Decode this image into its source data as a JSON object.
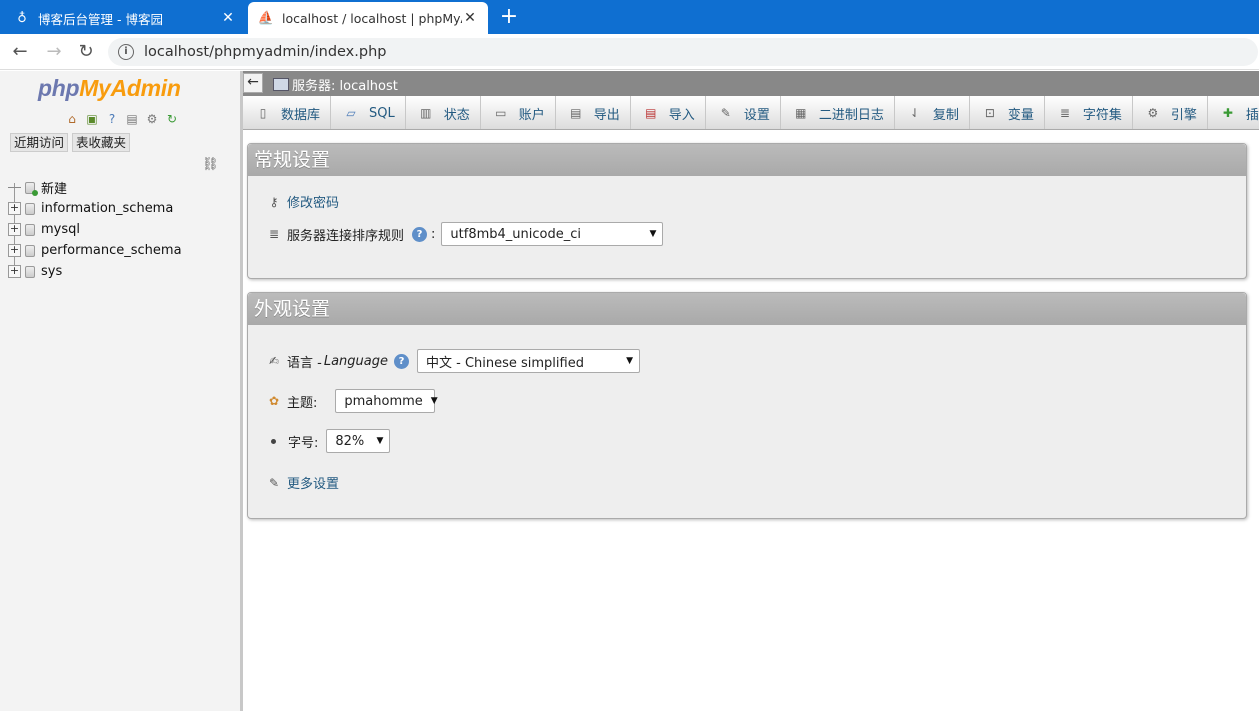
{
  "browser": {
    "tabs": [
      {
        "title": "博客后台管理 - 博客园",
        "active": false
      },
      {
        "title": "localhost / localhost | phpMyA",
        "active": true
      }
    ],
    "new_tab": "+",
    "url": "localhost/phpmyadmin/index.php"
  },
  "sidebar": {
    "logo_part1": "php",
    "logo_part2": "MyAdmin",
    "icons": [
      "home-icon",
      "exit-icon",
      "help-icon",
      "docs-icon",
      "settings-icon",
      "reload-icon"
    ],
    "quick_links": [
      "近期访问",
      "表收藏夹"
    ],
    "tree": [
      {
        "label": "新建",
        "type": "new"
      },
      {
        "label": "information_schema",
        "type": "db"
      },
      {
        "label": "mysql",
        "type": "db"
      },
      {
        "label": "performance_schema",
        "type": "db"
      },
      {
        "label": "sys",
        "type": "db"
      }
    ]
  },
  "serverbar": {
    "collapse": "←",
    "label": "服务器: localhost"
  },
  "menu": [
    {
      "label": "数据库",
      "icon": "database-icon"
    },
    {
      "label": "SQL",
      "icon": "sql-icon"
    },
    {
      "label": "状态",
      "icon": "status-icon"
    },
    {
      "label": "账户",
      "icon": "accounts-icon"
    },
    {
      "label": "导出",
      "icon": "export-icon"
    },
    {
      "label": "导入",
      "icon": "import-icon"
    },
    {
      "label": "设置",
      "icon": "settings-icon"
    },
    {
      "label": "二进制日志",
      "icon": "binlog-icon"
    },
    {
      "label": "复制",
      "icon": "replication-icon"
    },
    {
      "label": "变量",
      "icon": "variables-icon"
    },
    {
      "label": "字符集",
      "icon": "charset-icon"
    },
    {
      "label": "引擎",
      "icon": "engine-icon"
    },
    {
      "label": "插件",
      "icon": "plugin-icon"
    }
  ],
  "general": {
    "title": "常规设置",
    "change_password": "修改密码",
    "collation_label": "服务器连接排序规则",
    "collation_value": "utf8mb4_unicode_ci"
  },
  "appearance": {
    "title": "外观设置",
    "language_label": "语言 - ",
    "language_label_en": "Language",
    "language_value": "中文 - Chinese simplified",
    "theme_label": "主题:",
    "theme_value": "pmahomme",
    "font_label": "字号:",
    "font_value": "82%",
    "more_settings": "更多设置"
  }
}
